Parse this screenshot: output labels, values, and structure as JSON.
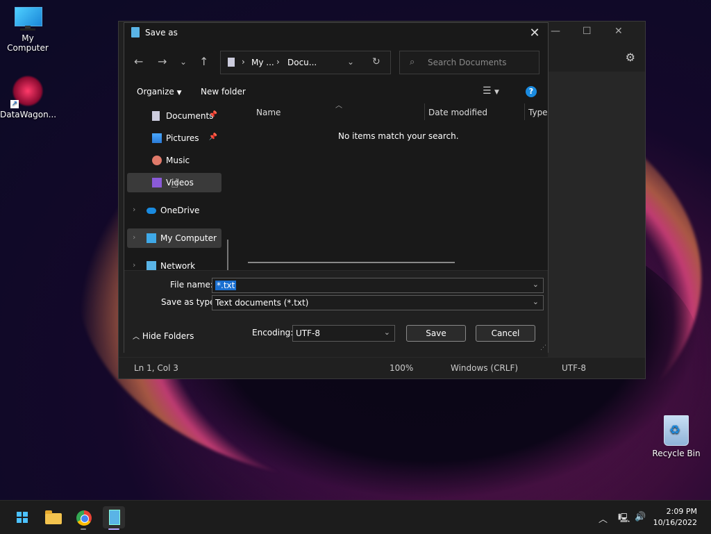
{
  "desktop": {
    "icons": [
      {
        "label": "My Computer"
      },
      {
        "label": "DataWagon..."
      },
      {
        "label": "Recycle Bin"
      }
    ]
  },
  "notepad": {
    "status": {
      "position": "Ln 1, Col 3",
      "zoom": "100%",
      "line_ending": "Windows (CRLF)",
      "encoding": "UTF-8"
    }
  },
  "dialog": {
    "title": "Save as",
    "address": {
      "crumb1": "My ...",
      "crumb2": "Docu..."
    },
    "search_placeholder": "Search Documents",
    "toolbar": {
      "organize": "Organize",
      "new_folder": "New folder"
    },
    "nav_items": [
      {
        "label": "Documents",
        "pinned": true
      },
      {
        "label": "Pictures",
        "pinned": true
      },
      {
        "label": "Music"
      },
      {
        "label": "Videos",
        "selected": true
      },
      {
        "label": "OneDrive"
      },
      {
        "label": "My Computer"
      },
      {
        "label": "Network"
      }
    ],
    "columns": {
      "name": "Name",
      "date_modified": "Date modified",
      "type": "Type"
    },
    "empty_message": "No items match your search.",
    "file_name_label": "File name:",
    "file_name_value": "*.txt",
    "save_as_type_label": "Save as type:",
    "save_as_type_value": "Text documents (*.txt)",
    "encoding_label": "Encoding:",
    "encoding_value": "UTF-8",
    "save_button": "Save",
    "cancel_button": "Cancel",
    "hide_folders": "Hide Folders"
  },
  "taskbar": {
    "time": "2:09 PM",
    "date": "10/16/2022"
  }
}
